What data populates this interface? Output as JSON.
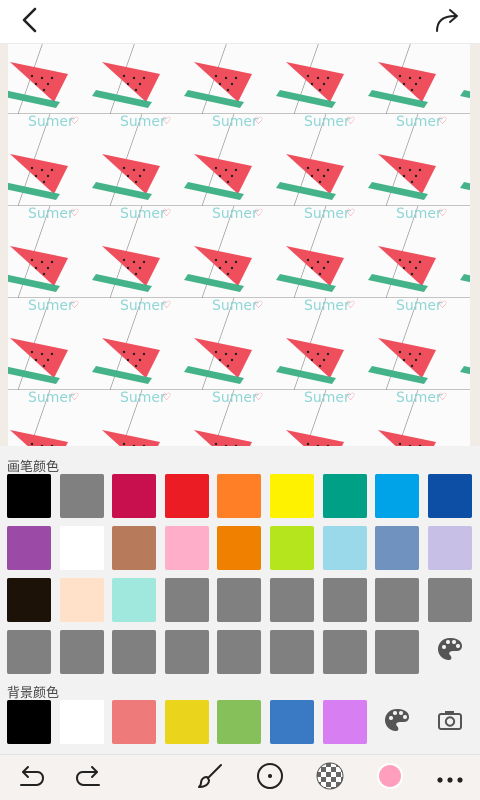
{
  "topbar": {
    "back_icon": "back-arrow-icon",
    "share_icon": "share-arrow-icon"
  },
  "canvas": {
    "pattern_text": "Sumer",
    "pattern_motif": "watermelon-slice"
  },
  "brush_colors": {
    "label": "画笔颜色",
    "rows": [
      [
        "#000000",
        "#808080",
        "#c8104f",
        "#ec1c24",
        "#ff7f27",
        "#fff200",
        "#00a086",
        "#00a2e8",
        "#0e4fa6"
      ],
      [
        "#9b4aa6",
        "#ffffff",
        "#b77a5a",
        "#ffaec9",
        "#f08000",
        "#b5e61d",
        "#99d9ea",
        "#7092be",
        "#c8bfe7"
      ],
      [
        "#1c1208",
        "#ffe0c8",
        "#a0e8de",
        "#808080",
        "#808080",
        "#808080",
        "#808080",
        "#808080",
        "#808080"
      ],
      [
        "#808080",
        "#808080",
        "#808080",
        "#808080",
        "#808080",
        "#808080",
        "#808080",
        "#808080"
      ]
    ],
    "palette_icon": "palette-icon"
  },
  "background_colors": {
    "label": "背景颜色",
    "swatches": [
      "#000000",
      "#ffffff",
      "#ef7a7a",
      "#ead41c",
      "#86c05a",
      "#3a7ac4",
      "#d67ef2"
    ],
    "palette_icon": "palette-icon",
    "camera_icon": "camera-icon"
  },
  "bottom_toolbar": {
    "items": [
      "undo-icon",
      "redo-icon",
      "brush-icon",
      "circle-dot-icon",
      "checkerboard-icon",
      "color-dot-icon",
      "more-icon"
    ],
    "current_color": "#ff9fbd"
  }
}
